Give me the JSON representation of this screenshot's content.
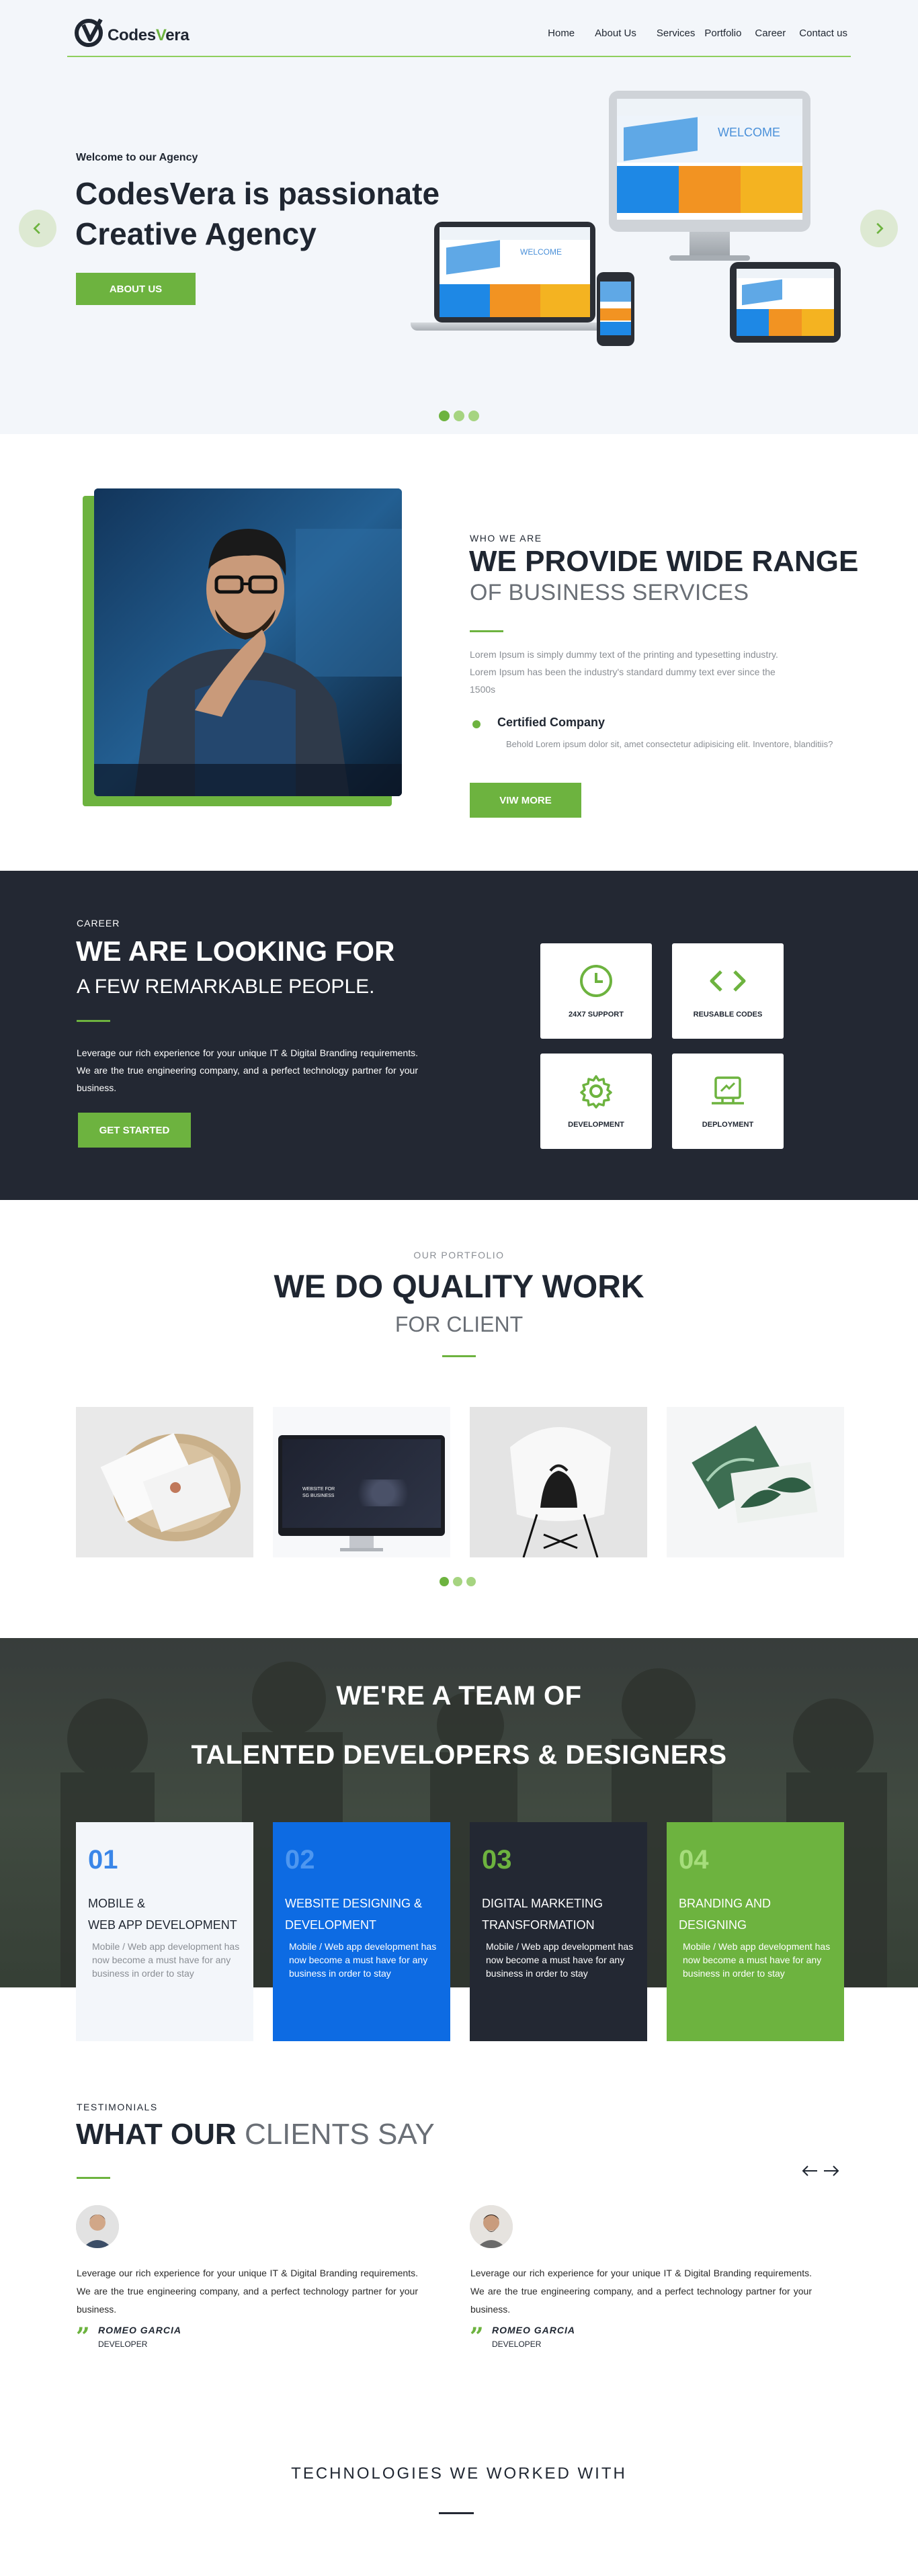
{
  "brand": {
    "name_a": "Codes",
    "name_v": "V",
    "name_b": "era"
  },
  "nav": [
    "Home",
    "About Us",
    "Services",
    "Portfolio",
    "Career",
    "Contact us"
  ],
  "hero": {
    "kicker": "Welcome to our Agency",
    "title_line1": "CodesVera is passionate",
    "title_line2": "Creative Agency",
    "button": "ABOUT US",
    "screen_word": "WELCOME",
    "slides": 3,
    "active_slide": 1
  },
  "who": {
    "kicker": "WHO WE ARE",
    "title": "WE PROVIDE WIDE RANGE",
    "subtitle": "OF BUSINESS SERVICES",
    "text": "Lorem Ipsum is simply dummy text of the printing and typesetting industry. Lorem Ipsum has been the industry's standard dummy text ever since the 1500s",
    "feature_title": "Certified Company",
    "feature_text": "Behold Lorem ipsum dolor sit, amet consectetur adipisicing elit. Inventore, blanditiis?",
    "button": "VIW MORE"
  },
  "career": {
    "kicker": "CAREER",
    "title": "WE ARE LOOKING FOR",
    "subtitle": "A FEW REMARKABLE PEOPLE.",
    "text": "Leverage our rich experience for your unique IT & Digital Branding requirements. We are the true engineering company, and a perfect technology partner for your business.",
    "button": "GET STARTED",
    "cards": [
      "24X7 SUPPORT",
      "REUSABLE CODES",
      "DEVELOPMENT",
      "DEPLOYMENT"
    ]
  },
  "portfolio": {
    "kicker": "OUR PORTFOLIO",
    "title": "WE DO QUALITY WORK",
    "subtitle": "FOR CLIENT",
    "monitor_text": "WEBSITE FOR SG BUSINESS",
    "slides": 3,
    "active_slide": 1
  },
  "team": {
    "title_line1": "WE'RE A TEAM OF",
    "title_line2": "TALENTED DEVELOPERS & DESIGNERS",
    "services": [
      {
        "num": "01",
        "line1": "MOBILE &",
        "line2": "WEB APP DEVELOPMENT",
        "desc": "Mobile / Web app development has now become a must have for any business in order to stay"
      },
      {
        "num": "02",
        "line1": "WEBSITE DESIGNING &",
        "line2": "DEVELOPMENT",
        "desc": "Mobile / Web app development has now become a must have for any business in order to stay"
      },
      {
        "num": "03",
        "line1": "DIGITAL MARKETING",
        "line2": "TRANSFORMATION",
        "desc": "Mobile / Web app development has now become a must have for any business in order to stay"
      },
      {
        "num": "04",
        "line1": "BRANDING AND",
        "line2": "DESIGNING",
        "desc": "Mobile / Web app development has now become a must have for any business in order to stay"
      }
    ]
  },
  "testimonials": {
    "kicker": "TESTIMONIALS",
    "title_bold": "WHAT OUR",
    "title_thin": "CLIENTS SAY",
    "items": [
      {
        "quote": "Leverage our rich experience for your unique IT & Digital Branding requirements. We are the true engineering company, and a perfect technology partner for your business.",
        "name": "ROMEO GARCIA",
        "role": "DEVELOPER"
      },
      {
        "quote": "Leverage our rich experience for your unique IT & Digital Branding requirements. We are the true engineering company, and a perfect technology partner for your business.",
        "name": "ROMEO GARCIA",
        "role": "DEVELOPER"
      }
    ]
  },
  "tech": {
    "title": "TECHNOLOGIES WE WORKED WITH"
  },
  "colors": {
    "accent": "#6db33f",
    "dark": "#232833",
    "blue": "#0d6be3",
    "light": "#f3f6fa"
  }
}
